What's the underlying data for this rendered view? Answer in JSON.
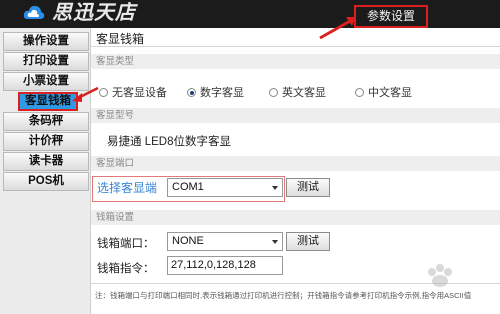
{
  "header": {
    "brand": "思迅天店",
    "settings_button": "参数设置"
  },
  "sidebar": {
    "items": [
      {
        "label": "操作设置"
      },
      {
        "label": "打印设置"
      },
      {
        "label": "小票设置"
      },
      {
        "label": "客显钱箱"
      },
      {
        "label": "条码秤"
      },
      {
        "label": "计价秤"
      },
      {
        "label": "读卡器"
      },
      {
        "label": "POS机"
      }
    ]
  },
  "main": {
    "title": "客显钱箱",
    "display_type": {
      "header": "客显类型",
      "options": [
        {
          "label": "无客显设备",
          "selected": false
        },
        {
          "label": "数字客显",
          "selected": true
        },
        {
          "label": "英文客显",
          "selected": false
        },
        {
          "label": "中文客显",
          "selected": false
        }
      ]
    },
    "display_model": {
      "header": "客显型号",
      "value": "易捷通 LED8位数字客显"
    },
    "display_port": {
      "header": "客显端口",
      "label": "选择客显端",
      "value": "COM1",
      "test_button": "测试"
    },
    "cash_drawer": {
      "header": "钱箱设置",
      "port_label": "钱箱端口：",
      "port_value": "NONE",
      "test_button": "测试",
      "command_label": "钱箱指令：",
      "command_value": "27,112,0,128,128"
    },
    "note": "注：钱箱端口与打印端口相同时,表示钱箱通过打印机进行控制；开钱箱指令请参考打印机指令示例,指令用ASCII值"
  },
  "colors": {
    "header_bg": "#1b1b1b",
    "active_item": "#2f9ae6",
    "highlight": "#d9201f"
  }
}
